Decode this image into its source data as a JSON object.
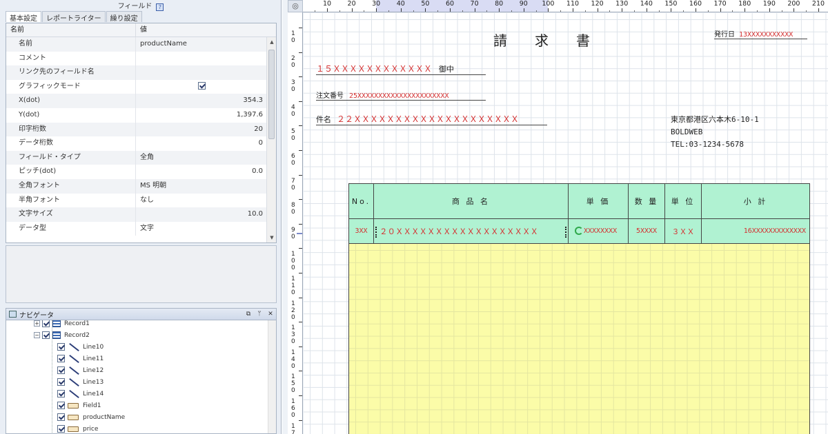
{
  "property_panel": {
    "title": "フィールド",
    "help_icon": "?",
    "tabs": [
      "基本設定",
      "レポートライター",
      "繰り設定"
    ],
    "column_headers": {
      "name": "名前",
      "value": "値"
    },
    "rows": [
      {
        "name": "名前",
        "value": "productName"
      },
      {
        "name": "コメント",
        "value": ""
      },
      {
        "name": "リンク先のフィールド名",
        "value": ""
      },
      {
        "name": "グラフィックモード",
        "value": "checked"
      },
      {
        "name": "X(dot)",
        "value": "354.3"
      },
      {
        "name": "Y(dot)",
        "value": "1,397.6"
      },
      {
        "name": "印字桁数",
        "value": "20"
      },
      {
        "name": "データ桁数",
        "value": "0"
      },
      {
        "name": "フィールド・タイプ",
        "value": "全角"
      },
      {
        "name": "ピッチ(dot)",
        "value": "0.0"
      },
      {
        "name": "全角フォント",
        "value": "MS 明朝"
      },
      {
        "name": "半角フォント",
        "value": "なし"
      },
      {
        "name": "文字サイズ",
        "value": "10.0"
      },
      {
        "name": "データ型",
        "value": "文字"
      }
    ]
  },
  "navigator": {
    "title": "ナビゲータ",
    "buttons": [
      "⧉",
      "ᛘ",
      "✕"
    ],
    "items": [
      {
        "label": "Record1",
        "type": "record"
      },
      {
        "label": "Record2",
        "type": "record"
      },
      {
        "label": "Line10",
        "type": "line"
      },
      {
        "label": "Line11",
        "type": "line"
      },
      {
        "label": "Line12",
        "type": "line"
      },
      {
        "label": "Line13",
        "type": "line"
      },
      {
        "label": "Line14",
        "type": "line"
      },
      {
        "label": "Field1",
        "type": "field"
      },
      {
        "label": "productName",
        "type": "field"
      },
      {
        "label": "price",
        "type": "field"
      }
    ]
  },
  "ruler": {
    "horizontal": [
      "10",
      "20",
      "30",
      "40",
      "50",
      "60",
      "70",
      "80",
      "90",
      "100",
      "110",
      "120",
      "130",
      "140",
      "150",
      "160",
      "170",
      "180",
      "190",
      "200",
      "210"
    ],
    "vertical": [
      [
        "1",
        "0"
      ],
      [
        "2",
        "0"
      ],
      [
        "3",
        "0"
      ],
      [
        "4",
        "0"
      ],
      [
        "5",
        "0"
      ],
      [
        "6",
        "0"
      ],
      [
        "7",
        "0"
      ],
      [
        "8",
        "0"
      ],
      [
        "9",
        "0"
      ],
      [
        "1",
        "0",
        "0"
      ],
      [
        "1",
        "1",
        "0"
      ],
      [
        "1",
        "2",
        "0"
      ],
      [
        "1",
        "3",
        "0"
      ],
      [
        "1",
        "4",
        "0"
      ],
      [
        "1",
        "5",
        "0"
      ],
      [
        "1",
        "6",
        "0"
      ],
      [
        "1",
        "7",
        "0"
      ]
    ]
  },
  "document": {
    "title": "請　　求　　書",
    "issue_date_label": "発行日",
    "issue_date_value": "13XXXXXXXXXXX",
    "customer_field": "１５ＸＸＸＸＸＸＸＸＸＸＸＸ",
    "customer_suffix": "御中",
    "order_label": "注文番号",
    "order_value": "25XXXXXXXXXXXXXXXXXXXXXX",
    "subject_label": "件名",
    "subject_value": "２２ＸＸＸＸＸＸＸＸＸＸＸＸＸＸＸＸＸＸＸＸ",
    "address_line1": "東京都港区六本木6-10-1",
    "address_line2": "BOLDWEB",
    "address_line3": "TEL:03-1234-5678",
    "table_headers": [
      "No.",
      "商 品 名",
      "単 価",
      "数 量",
      "単 位",
      "小 計"
    ],
    "table_row": [
      "3XX",
      "２０ＸＸＸＸＸＸＸＸＸＸＸＸＸＸＸＸＸＸ",
      "XXXXXXXX",
      "5XXXX",
      "３ＸＸ",
      "16XXXXXXXXXXXXX"
    ]
  },
  "colors": {
    "header_fill": "#b0f2d2",
    "detail_fill": "#fbfca8",
    "field_text": "#d43030"
  }
}
